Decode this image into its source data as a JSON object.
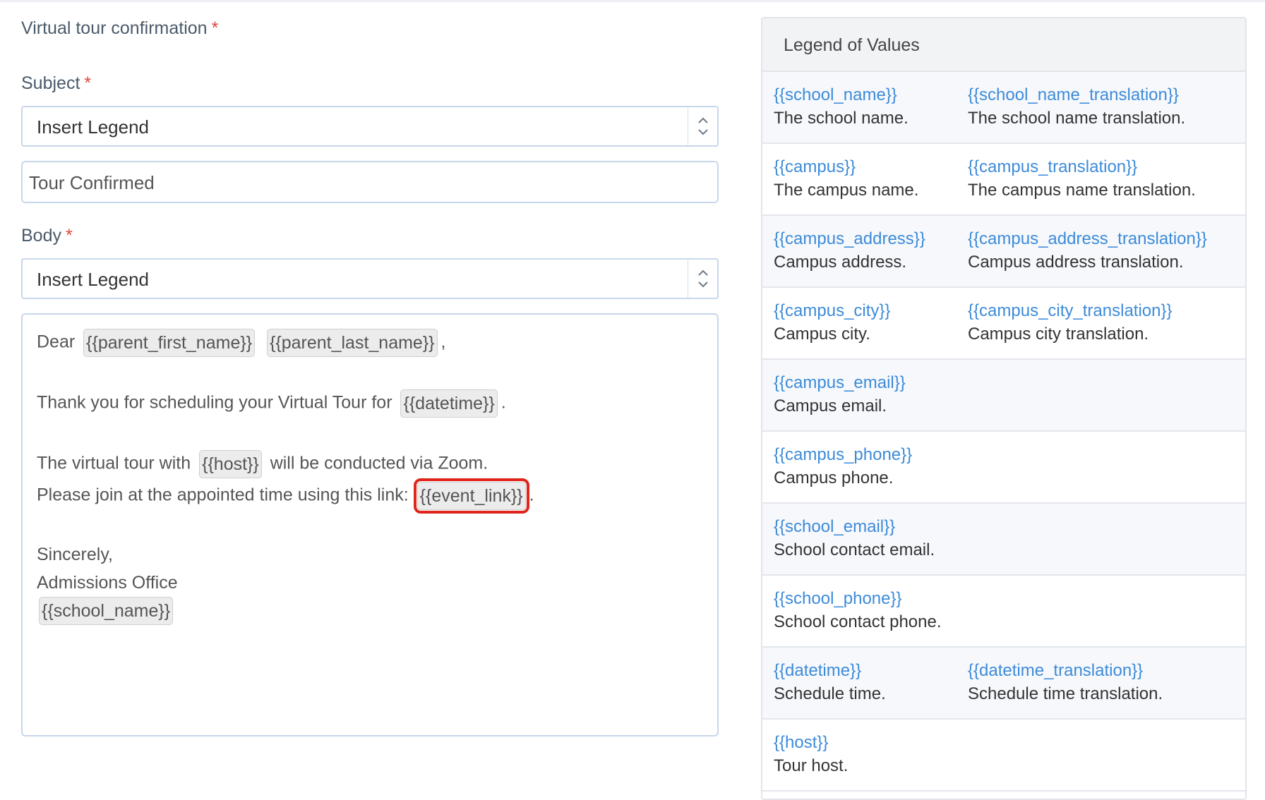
{
  "form": {
    "title": "Virtual tour confirmation",
    "required_mark": "*",
    "subject": {
      "label": "Subject",
      "insert_legend": "Insert Legend",
      "value": "Tour Confirmed"
    },
    "body": {
      "label": "Body",
      "insert_legend": "Insert Legend",
      "lines": {
        "l1": {
          "text": "Dear",
          "chip1": "{{parent_first_name}}",
          "chip2": "{{parent_last_name}}",
          "tail": ","
        },
        "l2": {
          "text": "Thank you for scheduling your Virtual Tour for",
          "chip": "{{datetime}}",
          "tail": "."
        },
        "l3": {
          "text": "The virtual tour with",
          "chip": "{{host}}",
          "tail": "will be conducted via Zoom."
        },
        "l4": {
          "text": "Please join at the appointed time using this link:",
          "chip": "{{event_link}}",
          "tail": "."
        },
        "l5": {
          "text": "Sincerely,"
        },
        "l6": {
          "text": "Admissions Office"
        },
        "l7": {
          "chip": "{{school_name}}"
        }
      }
    }
  },
  "legend": {
    "title": "Legend of Values",
    "rows": [
      {
        "a_token": "{{school_name}}",
        "a_desc": "The school name.",
        "b_token": "{{school_name_translation}}",
        "b_desc": "The school name translation."
      },
      {
        "a_token": "{{campus}}",
        "a_desc": "The campus name.",
        "b_token": "{{campus_translation}}",
        "b_desc": "The campus name translation."
      },
      {
        "a_token": "{{campus_address}}",
        "a_desc": "Campus address.",
        "b_token": "{{campus_address_translation}}",
        "b_desc": "Campus address translation."
      },
      {
        "a_token": "{{campus_city}}",
        "a_desc": "Campus city.",
        "b_token": "{{campus_city_translation}}",
        "b_desc": "Campus city translation."
      },
      {
        "a_token": "{{campus_email}}",
        "a_desc": "Campus email."
      },
      {
        "a_token": "{{campus_phone}}",
        "a_desc": "Campus phone."
      },
      {
        "a_token": "{{school_email}}",
        "a_desc": "School contact email."
      },
      {
        "a_token": "{{school_phone}}",
        "a_desc": "School contact phone."
      },
      {
        "a_token": "{{datetime}}",
        "a_desc": "Schedule time.",
        "b_token": "{{datetime_translation}}",
        "b_desc": "Schedule time translation."
      },
      {
        "a_token": "{{host}}",
        "a_desc": "Tour host."
      }
    ]
  }
}
